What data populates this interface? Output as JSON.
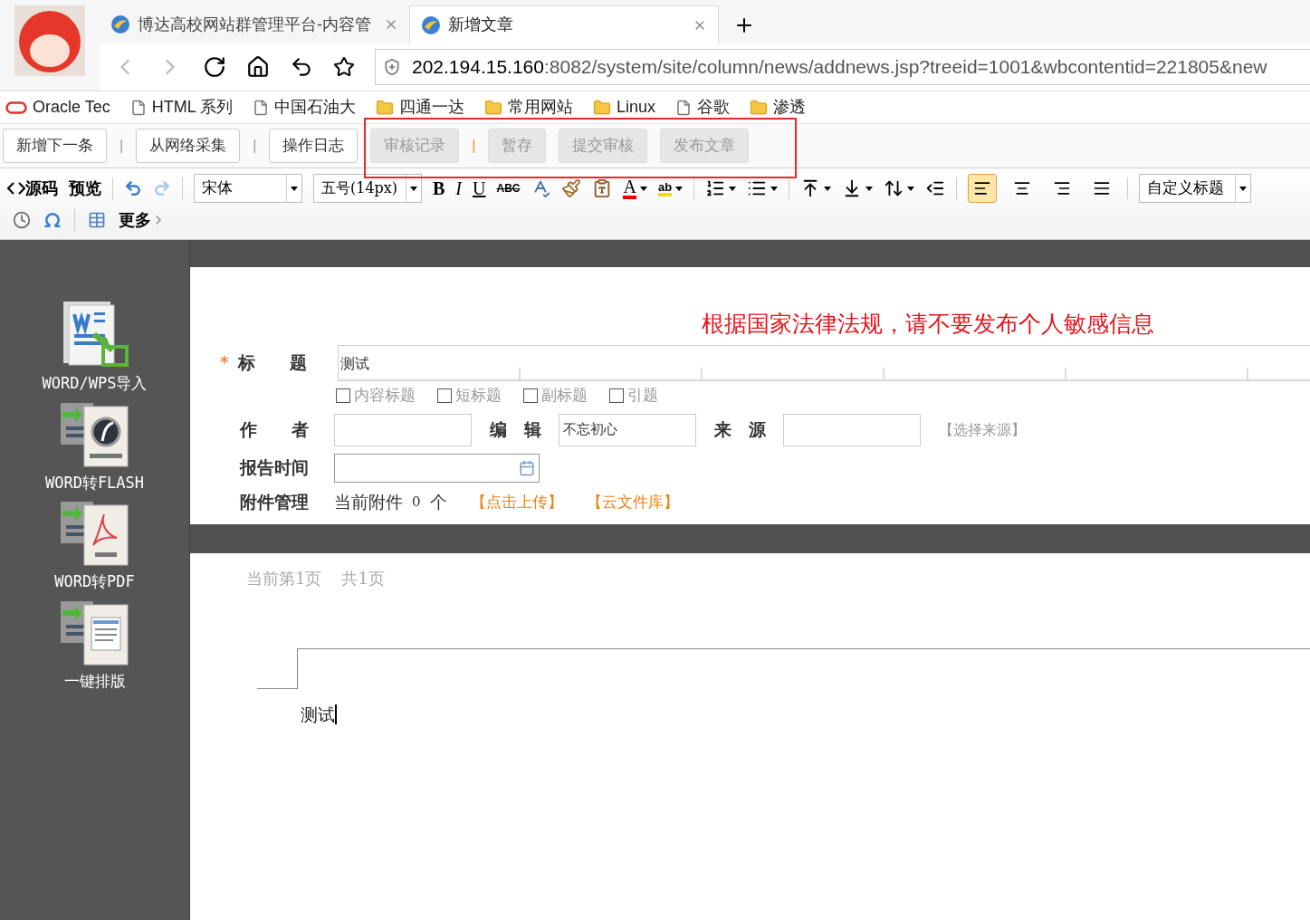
{
  "browser": {
    "tabs": [
      {
        "title": "博达高校网站群管理平台-内容管",
        "selected": false
      },
      {
        "title": "新增文章",
        "selected": true
      }
    ],
    "address": {
      "host": "202.194.15.160",
      "rest": ":8082/system/site/column/news/addnews.jsp?treeid=1001&wbcontentid=221805&new"
    },
    "bookmarks": [
      {
        "label": "Oracle Tec",
        "kind": "oracle"
      },
      {
        "label": "HTML 系列",
        "kind": "page"
      },
      {
        "label": "中国石油大",
        "kind": "page"
      },
      {
        "label": "四通一达",
        "kind": "folder"
      },
      {
        "label": "常用网站",
        "kind": "folder"
      },
      {
        "label": "Linux",
        "kind": "folder"
      },
      {
        "label": "谷歌",
        "kind": "page"
      },
      {
        "label": "渗透",
        "kind": "folder"
      }
    ]
  },
  "actions": [
    {
      "kind": "button",
      "label": "新增下一条",
      "disabled": false
    },
    {
      "kind": "separator",
      "label": "|"
    },
    {
      "kind": "button",
      "label": "从网络采集",
      "disabled": false
    },
    {
      "kind": "separator",
      "label": "|"
    },
    {
      "kind": "button",
      "label": "操作日志",
      "disabled": false
    },
    {
      "kind": "button",
      "label": "审核记录",
      "disabled": true
    },
    {
      "kind": "separator",
      "label": "|"
    },
    {
      "kind": "button",
      "label": "暂存",
      "disabled": true
    },
    {
      "kind": "button",
      "label": "提交审核",
      "disabled": true
    },
    {
      "kind": "button",
      "label": "发布文章",
      "disabled": true
    }
  ],
  "editor_toolbar": {
    "source": "源码",
    "preview": "预览",
    "font": "宋体",
    "size": "五号(14px)",
    "bold": "B",
    "italic": "I",
    "underline": "U",
    "strike": "ABC",
    "font_color": "A",
    "highlight": "ab",
    "heading": "自定义标题",
    "more": "更多",
    "alignments": [
      {
        "kind": "left",
        "selected": true
      },
      {
        "kind": "center",
        "selected": false
      },
      {
        "kind": "right",
        "selected": false
      },
      {
        "kind": "justify",
        "selected": false
      }
    ]
  },
  "tools": [
    {
      "kind": "word",
      "label": "WORD/WPS导入"
    },
    {
      "kind": "flash",
      "label": "WORD转FLASH"
    },
    {
      "kind": "pdf",
      "label": "WORD转PDF"
    },
    {
      "kind": "layout",
      "label": "一键排版"
    }
  ],
  "form": {
    "notice": "根据国家法律法规，请不要发布个人敏感信息",
    "required_mark": "*",
    "title_label": "标　　题",
    "title_value": "测试",
    "title_options": [
      {
        "label": "内容标题",
        "checked": false
      },
      {
        "label": "短标题",
        "checked": false
      },
      {
        "label": "副标题",
        "checked": false
      },
      {
        "label": "引题",
        "checked": false
      }
    ],
    "author_label": "作　　者",
    "editor_label": "编　辑",
    "editor_value": "不忘初心",
    "source_label": "来　源",
    "source_link": "【选择来源】",
    "time_label": "报告时间",
    "attach_label": "附件管理",
    "attach_prefix": "当前附件",
    "attach_count": "0",
    "attach_unit": "个",
    "upload_link": "【点击上传】",
    "cloud_link": "【云文件库】"
  },
  "document": {
    "page_info": "当前第1页",
    "page_total": "共1页",
    "body": "测试"
  }
}
